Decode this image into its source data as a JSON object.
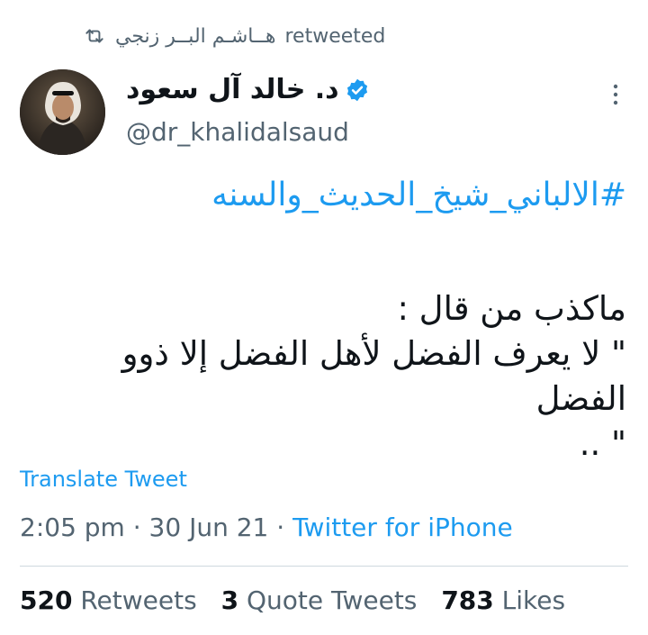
{
  "retweet": {
    "user": "هــاشـم البــر زنجي",
    "label": "retweeted"
  },
  "author": {
    "display_name": "د. خالد آل سعود",
    "handle": "@dr_khalidalsaud"
  },
  "tweet": {
    "hashtag": "#الالباني_شيخ_الحديث_والسنه",
    "line1": "ماكذب من قال :",
    "line2": "\" لا يعرف الفضل لأهل الفضل إلا ذوو الفضل",
    "line3": "\" .."
  },
  "translate_label": "Translate Tweet",
  "meta": {
    "time": "2:05 pm",
    "date": "30 Jun 21",
    "source": "Twitter for iPhone",
    "separator": "·"
  },
  "stats": {
    "retweets_count": "520",
    "retweets_label": "Retweets",
    "quotes_count": "3",
    "quotes_label": "Quote Tweets",
    "likes_count": "783",
    "likes_label": "Likes"
  },
  "colors": {
    "accent": "#1d9bf0",
    "muted": "#536471",
    "text": "#0f1419"
  }
}
